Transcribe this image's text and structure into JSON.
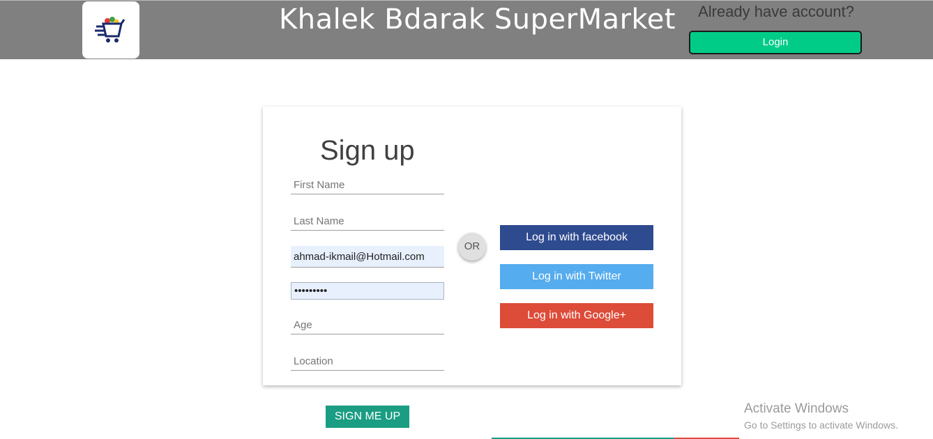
{
  "header": {
    "site_title": "Khalek Bdarak SuperMarket",
    "already_text": "Already have account?",
    "login_label": "Login",
    "logo_icon": "cart-logo-icon"
  },
  "signup": {
    "title": "Sign up",
    "fields": {
      "first_name": {
        "placeholder": "First Name",
        "value": ""
      },
      "last_name": {
        "placeholder": "Last Name",
        "value": ""
      },
      "email": {
        "placeholder": "",
        "value": "ahmad-ikmail@Hotmail.com"
      },
      "password": {
        "placeholder": "",
        "value": "•••••••••"
      },
      "age": {
        "placeholder": "Age",
        "value": ""
      },
      "location": {
        "placeholder": "Location",
        "value": ""
      }
    },
    "or_label": "OR",
    "social": {
      "facebook": "Log in with facebook",
      "twitter": "Log in with Twitter",
      "google": "Log in with Google+"
    },
    "submit_label": "SIGN ME UP"
  },
  "watermark": {
    "title": "Activate Windows",
    "subtitle": "Go to Settings to activate Windows."
  },
  "colors": {
    "header_bg": "#808080",
    "login_button": "#00cc88",
    "facebook": "#2f4b8f",
    "twitter": "#55acee",
    "google": "#dd4b39",
    "submit_button": "#1a9d82"
  }
}
